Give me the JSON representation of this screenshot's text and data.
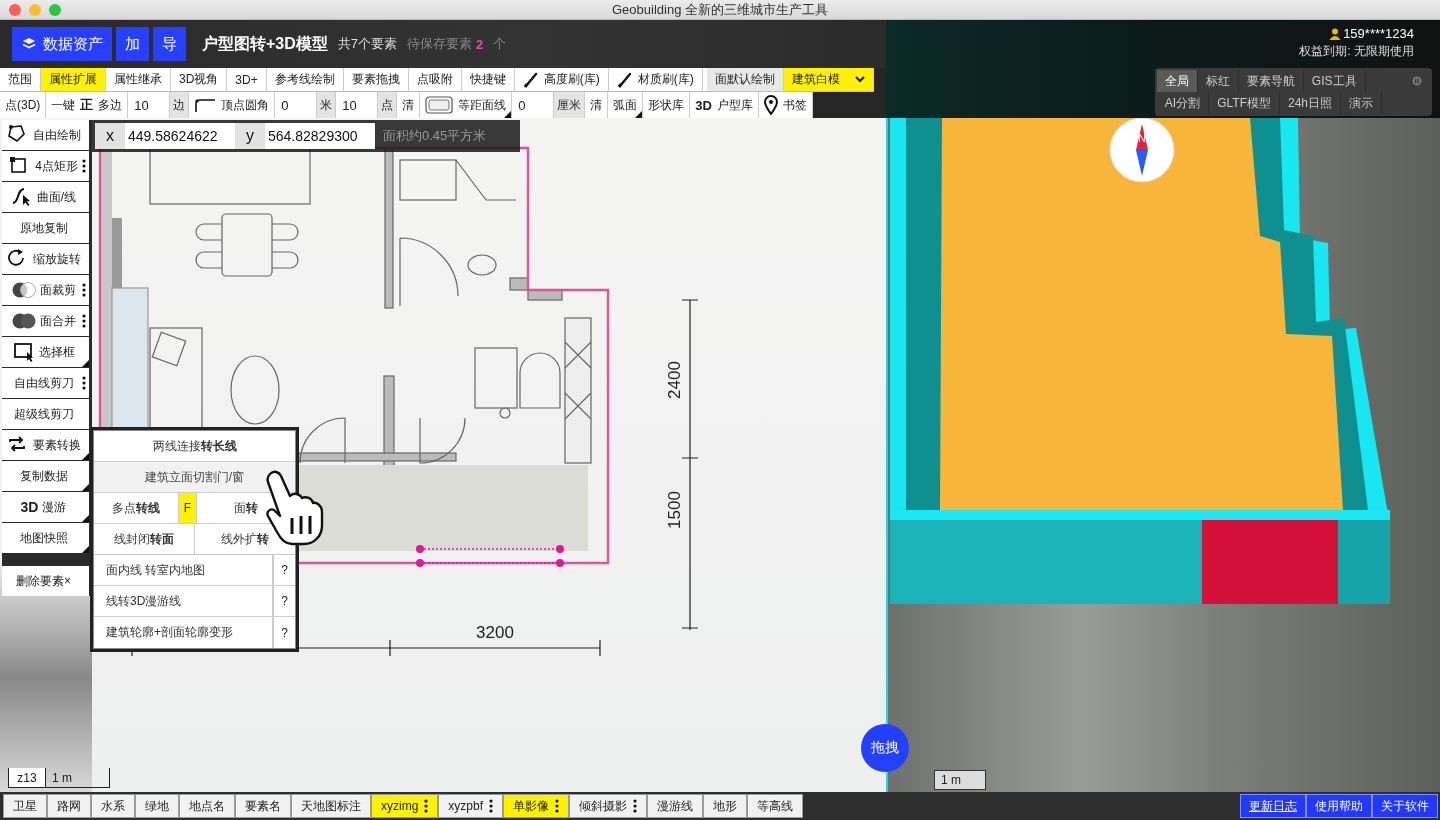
{
  "window": {
    "title": "Geobuilding 全新的三维城市生产工具"
  },
  "header": {
    "buttons": [
      {
        "label": "数据资产",
        "kind": "assets"
      },
      {
        "label": "加",
        "kind": "plain"
      },
      {
        "label": "导",
        "kind": "plain"
      }
    ],
    "project_title": "户型图转+3D模型",
    "element_count": "共7个要素",
    "pending_label": "待保存要素",
    "pending_count": "2",
    "pending_unit": "个"
  },
  "user": {
    "account": "159****1234",
    "entitlement": "权益到期: 无限期使用"
  },
  "toolbar_row1": [
    {
      "kind": "button",
      "label": "范围",
      "selected": false
    },
    {
      "kind": "button",
      "label": "属性扩展",
      "selected": true
    },
    {
      "kind": "button",
      "label": "属性继承",
      "selected": false
    },
    {
      "kind": "button",
      "label": "3D视角",
      "selected": false
    },
    {
      "kind": "button",
      "label": "3D+",
      "selected": false
    },
    {
      "kind": "button",
      "label": "参考线绘制",
      "selected": false
    },
    {
      "kind": "button",
      "label": "要素拖拽",
      "selected": false
    },
    {
      "kind": "button",
      "label": "点吸附",
      "selected": false
    },
    {
      "kind": "button",
      "label": "快捷键",
      "selected": false
    },
    {
      "kind": "brush",
      "label": "高度刷(库)",
      "selected": false
    },
    {
      "kind": "brush",
      "label": "材质刷(库)",
      "selected": false
    },
    {
      "kind": "mode",
      "label": "面默认绘制",
      "selected": false
    },
    {
      "kind": "dropdown",
      "label": "建筑白模",
      "selected": true
    }
  ],
  "toolbar_row2": [
    {
      "kind": "button",
      "label": "点(3D)",
      "submenu": false
    },
    {
      "kind": "button",
      "label": "一键**正**多边",
      "submenu": false
    },
    {
      "kind": "field",
      "value": "10"
    },
    {
      "kind": "unit",
      "label": "边"
    },
    {
      "kind": "corner-tool",
      "label": "顶点圆角",
      "submenu": false
    },
    {
      "kind": "field",
      "value": "0"
    },
    {
      "kind": "unit",
      "label": "米"
    },
    {
      "kind": "field",
      "value": "10"
    },
    {
      "kind": "unit",
      "label": "点"
    },
    {
      "kind": "button",
      "label": "清",
      "submenu": false
    },
    {
      "kind": "offset-tool",
      "label": "等距面线",
      "submenu": true
    },
    {
      "kind": "field",
      "value": "0"
    },
    {
      "kind": "unit",
      "label": "厘米"
    },
    {
      "kind": "button",
      "label": "清",
      "submenu": false
    },
    {
      "kind": "button",
      "label": "弧面",
      "submenu": true
    },
    {
      "kind": "button",
      "label": "形状库",
      "submenu": false
    },
    {
      "kind": "button",
      "label": "**3D**户型库",
      "submenu": false
    },
    {
      "kind": "bookmark",
      "label": "书签",
      "submenu": false
    }
  ],
  "panel": {
    "tab_rows": [
      {
        "tabs": [
          {
            "label": "全局",
            "selected": true
          },
          {
            "label": "标红",
            "selected": false
          },
          {
            "label": "要素导航",
            "selected": false
          },
          {
            "label": "GIS工具",
            "selected": false
          }
        ]
      },
      {
        "tabs": [
          {
            "label": "AI分割",
            "selected": false
          },
          {
            "label": "GLTF模型",
            "selected": false
          },
          {
            "label": "24h日照",
            "selected": false
          },
          {
            "label": "演示",
            "selected": false
          }
        ]
      }
    ]
  },
  "tools": [
    {
      "kind": "polygon",
      "label": "自由绘制",
      "has_menu": false,
      "submenu": false
    },
    {
      "kind": "rect",
      "label": "4点矩形",
      "has_menu": true,
      "submenu": false
    },
    {
      "kind": "curve",
      "label": "曲面/线",
      "has_menu": false,
      "submenu": false
    },
    {
      "kind": "plain",
      "label": "原地复制",
      "has_menu": false,
      "submenu": false
    },
    {
      "kind": "rotate",
      "label": "缩放旋转",
      "has_menu": false,
      "submenu": false
    },
    {
      "kind": "clip",
      "label": "面裁剪",
      "has_menu": true,
      "submenu": false
    },
    {
      "kind": "merge",
      "label": "面合并",
      "has_menu": true,
      "submenu": false
    },
    {
      "kind": "select",
      "label": "选择框",
      "has_menu": false,
      "submenu": true
    },
    {
      "kind": "plain",
      "label": "自由线剪刀",
      "has_menu": true,
      "submenu": false
    },
    {
      "kind": "plain",
      "label": "超级线剪刀",
      "has_menu": false,
      "submenu": false
    },
    {
      "kind": "convert",
      "label": "要素转换",
      "has_menu": false,
      "submenu": true
    },
    {
      "kind": "plain",
      "label": "复制数据",
      "has_menu": false,
      "submenu": true
    },
    {
      "kind": "plain",
      "label": "**3D** 漫游",
      "has_menu": false,
      "submenu": true
    },
    {
      "kind": "plain",
      "label": "地图快照",
      "has_menu": false,
      "submenu": true
    },
    {
      "kind": "delete",
      "label": "删除要素×",
      "has_menu": false,
      "submenu": false
    }
  ],
  "coords": {
    "x_label": "x",
    "x_value": "449.58624622",
    "y_label": "y",
    "y_value": "564.82829300",
    "area": "面积约0.45平方米"
  },
  "convert_menu": {
    "rows": [
      {
        "kind": "single",
        "label": "两线连接**转长线**"
      },
      {
        "kind": "single",
        "label": "建筑立面切割门/窗"
      },
      {
        "kind": "pair",
        "left": "多点**转线**",
        "key": "F",
        "right": "面**转**"
      },
      {
        "kind": "pair",
        "left": "线封闭**转面**",
        "right": "线外扩**转**"
      },
      {
        "kind": "help",
        "label": "面内线 转室内地图",
        "help": "?"
      },
      {
        "kind": "help",
        "label": "线转3D漫游线",
        "help": "?"
      },
      {
        "kind": "help",
        "label": "建筑轮廓+剖面轮廓变形",
        "help": "?"
      }
    ]
  },
  "map": {
    "zoom_level": "z13",
    "scale": "1 m",
    "plan_dimensions": [
      "2400",
      "1500",
      "3200"
    ]
  },
  "drag_button": "拖拽",
  "view3d": {
    "compass_label": "N",
    "scale": "1 m"
  },
  "layers": [
    {
      "label": "卫星",
      "selected": false,
      "has_menu": false
    },
    {
      "label": "路网",
      "selected": false,
      "has_menu": false
    },
    {
      "label": "水系",
      "selected": false,
      "has_menu": false
    },
    {
      "label": "绿地",
      "selected": false,
      "has_menu": false
    },
    {
      "label": "地点名",
      "selected": false,
      "has_menu": false
    },
    {
      "label": "要素名",
      "selected": false,
      "has_menu": false
    },
    {
      "label": "天地图标注",
      "selected": false,
      "has_menu": false
    },
    {
      "label": "xyzimg",
      "selected": true,
      "has_menu": true
    },
    {
      "label": "xyzpbf",
      "selected": false,
      "has_menu": true
    },
    {
      "label": "单影像",
      "selected": true,
      "has_menu": true
    },
    {
      "label": "倾斜摄影",
      "selected": false,
      "has_menu": true
    },
    {
      "label": "漫游线",
      "selected": false,
      "has_menu": false
    },
    {
      "label": "地形",
      "selected": false,
      "has_menu": false
    },
    {
      "label": "等高线",
      "selected": false,
      "has_menu": false
    }
  ],
  "links": [
    {
      "label": "更新日志",
      "selected": true
    },
    {
      "label": "使用帮助",
      "selected": false
    },
    {
      "label": "关于软件",
      "selected": false
    }
  ]
}
